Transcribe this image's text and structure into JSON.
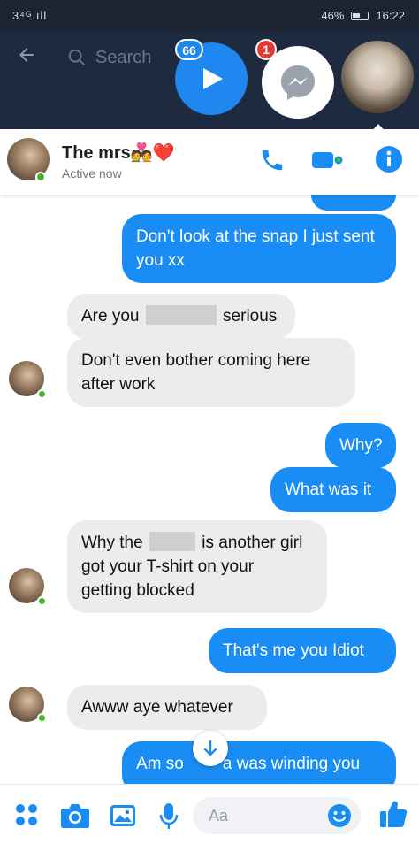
{
  "status_bar": {
    "signal": "3⁴ᴳ.ıll",
    "battery": "46%",
    "time": "16:22"
  },
  "search": {
    "placeholder": "Search"
  },
  "chat_heads": {
    "video_badge": "66",
    "messenger_badge": "1"
  },
  "conversation": {
    "name": "The mrs💑❤️",
    "status": "Active now",
    "messages": [
      {
        "from": "me",
        "text": "Don't look at the snap I just sent you xx"
      },
      {
        "from": "them",
        "text_before": "Are you",
        "text_after": "serious"
      },
      {
        "from": "them",
        "text": "Don't even bother coming here after work"
      },
      {
        "from": "me",
        "text": "Why?"
      },
      {
        "from": "me",
        "text": "What was it"
      },
      {
        "from": "them",
        "line1_before": "Why the",
        "line1_after": "is another girl",
        "line2": "got your T-shirt on your",
        "line3": "getting blocked"
      },
      {
        "from": "me",
        "text": "That's me you Idiot"
      },
      {
        "from": "them",
        "text": "Awww aye whatever"
      },
      {
        "from": "me",
        "text_left": "Am so",
        "text_right": "a was winding you"
      }
    ]
  },
  "composer": {
    "placeholder": "Aa"
  },
  "colors": {
    "accent": "#1a8cf5",
    "online": "#42b72a",
    "badge_red": "#e53935",
    "incoming_bubble": "#ececec"
  },
  "icons": [
    "back-arrow-icon",
    "search-icon",
    "play-icon",
    "messenger-icon",
    "phone-icon",
    "video-camera-icon",
    "info-icon",
    "menu-dots-icon",
    "camera-icon",
    "image-icon",
    "microphone-icon",
    "emoji-icon",
    "thumbs-up-icon",
    "arrow-down-icon"
  ]
}
